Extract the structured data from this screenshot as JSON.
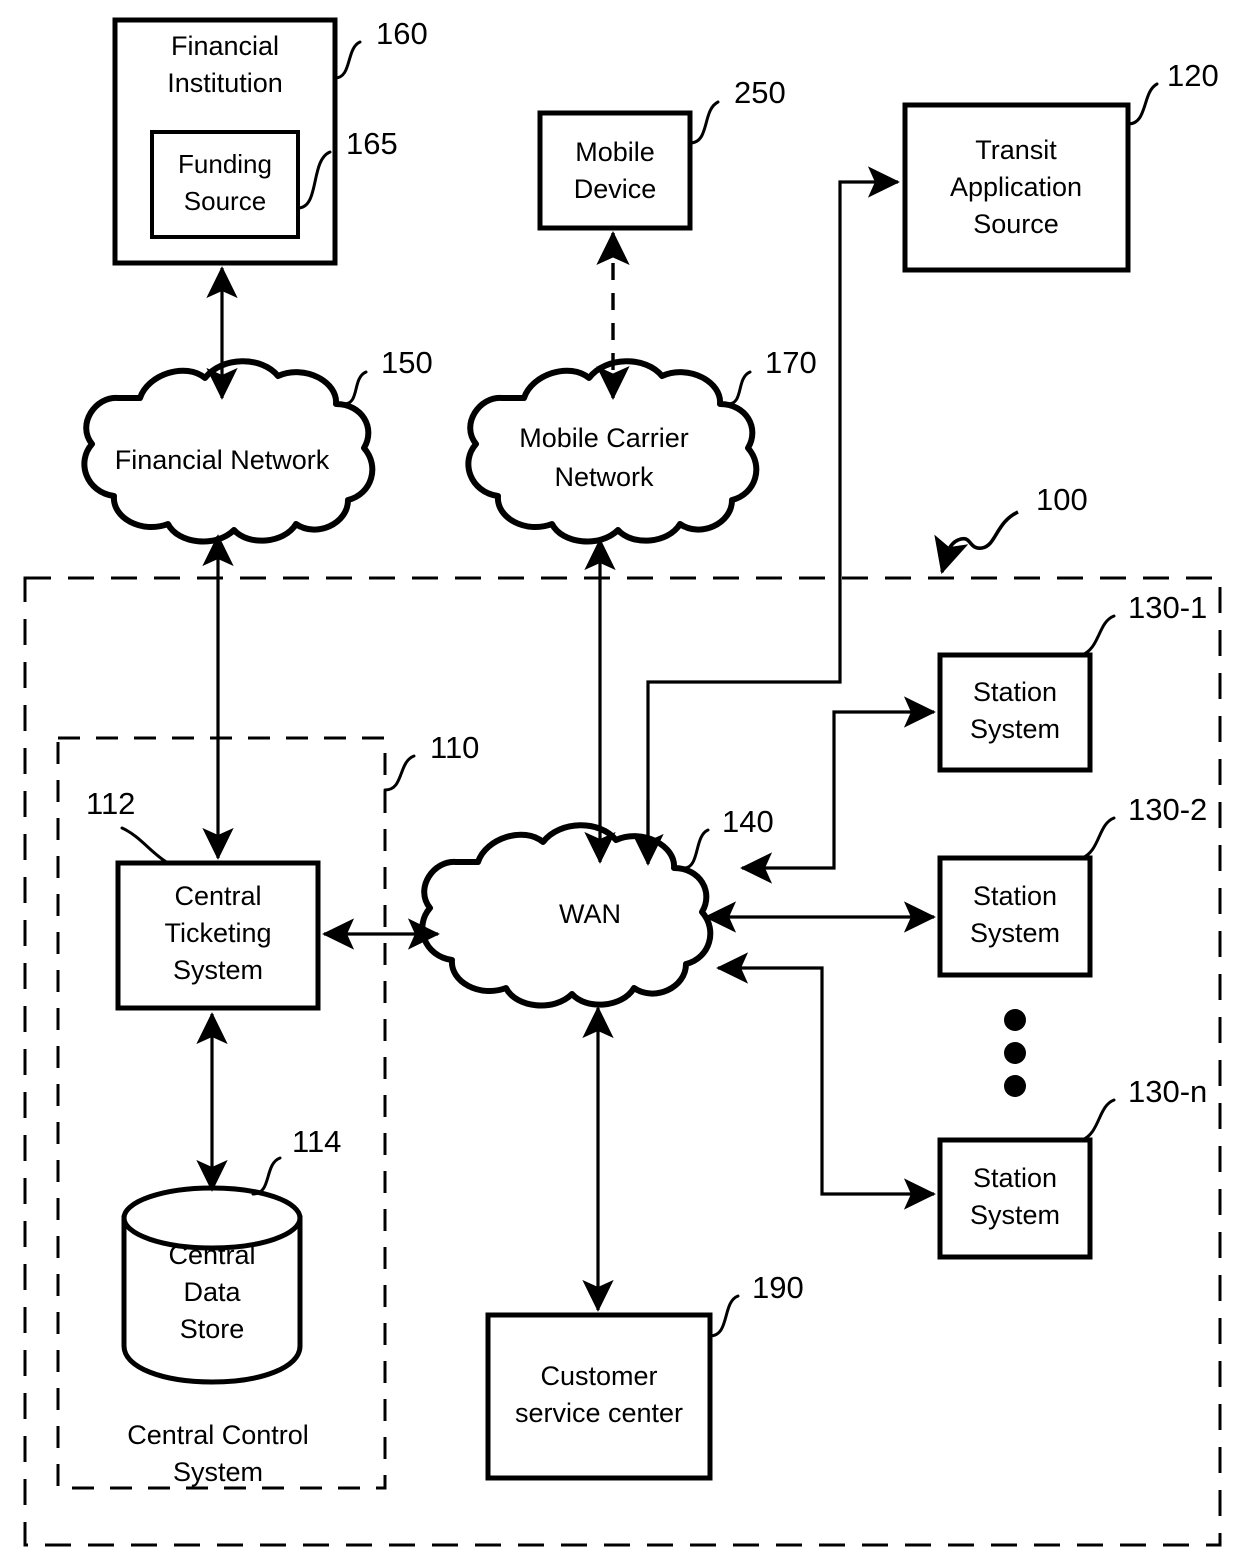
{
  "figure": {
    "type": "patent-system-block-diagram",
    "background": "#ffffff",
    "line_color": "#000000"
  },
  "nodes": {
    "financial_institution": {
      "label_line1": "Financial",
      "label_line2": "Institution",
      "ref": "160",
      "shape": "rectangle"
    },
    "funding_source": {
      "label_line1": "Funding",
      "label_line2": "Source",
      "ref": "165",
      "shape": "rectangle"
    },
    "mobile_device": {
      "label_line1": "Mobile",
      "label_line2": "Device",
      "ref": "250",
      "shape": "rectangle"
    },
    "transit_application_source": {
      "label_line1": "Transit",
      "label_line2": "Application",
      "label_line3": "Source",
      "ref": "120",
      "shape": "rectangle"
    },
    "financial_network": {
      "label_line1": "Financial Network",
      "ref": "150",
      "shape": "cloud"
    },
    "mobile_carrier_network": {
      "label_line1": "Mobile Carrier",
      "label_line2": "Network",
      "ref": "170",
      "shape": "cloud"
    },
    "wan": {
      "label_line1": "WAN",
      "ref": "140",
      "shape": "cloud"
    },
    "central_ticketing_system": {
      "label_line1": "Central",
      "label_line2": "Ticketing",
      "label_line3": "System",
      "ref": "112",
      "shape": "rectangle"
    },
    "central_data_store": {
      "label_line1": "Central",
      "label_line2": "Data",
      "label_line3": "Store",
      "ref": "114",
      "shape": "cylinder"
    },
    "station_system_1": {
      "label_line1": "Station",
      "label_line2": "System",
      "ref": "130-1",
      "shape": "rectangle"
    },
    "station_system_2": {
      "label_line1": "Station",
      "label_line2": "System",
      "ref": "130-2",
      "shape": "rectangle"
    },
    "station_system_n": {
      "label_line1": "Station",
      "label_line2": "System",
      "ref": "130-n",
      "shape": "rectangle"
    },
    "customer_service_center": {
      "label_line1": "Customer",
      "label_line2": "service center",
      "ref": "190",
      "shape": "rectangle"
    }
  },
  "regions": {
    "system_boundary": {
      "ref": "100",
      "style": "dashed",
      "label": ""
    },
    "central_control_system": {
      "ref": "110",
      "style": "dashed",
      "label_line1": "Central Control",
      "label_line2": "System"
    }
  },
  "ellipsis": {
    "name": "vertical-ellipsis",
    "dot_count": 3
  },
  "connections": [
    {
      "from": "financial_institution",
      "to": "financial_network",
      "style": "solid",
      "arrows": "both"
    },
    {
      "from": "financial_network",
      "to": "central_ticketing_system",
      "style": "solid",
      "arrows": "both"
    },
    {
      "from": "mobile_device",
      "to": "mobile_carrier_network",
      "style": "dashed",
      "arrows": "both"
    },
    {
      "from": "mobile_carrier_network",
      "to": "wan",
      "style": "solid",
      "arrows": "both"
    },
    {
      "from": "wan",
      "to": "transit_application_source",
      "style": "solid",
      "arrows": "to-transit"
    },
    {
      "from": "central_ticketing_system",
      "to": "wan",
      "style": "solid",
      "arrows": "both"
    },
    {
      "from": "central_ticketing_system",
      "to": "central_data_store",
      "style": "solid",
      "arrows": "both"
    },
    {
      "from": "wan",
      "to": "station_system_1",
      "style": "solid",
      "arrows": "both"
    },
    {
      "from": "wan",
      "to": "station_system_2",
      "style": "solid",
      "arrows": "both"
    },
    {
      "from": "wan",
      "to": "station_system_n",
      "style": "solid",
      "arrows": "both"
    },
    {
      "from": "wan",
      "to": "customer_service_center",
      "style": "solid",
      "arrows": "both"
    }
  ]
}
